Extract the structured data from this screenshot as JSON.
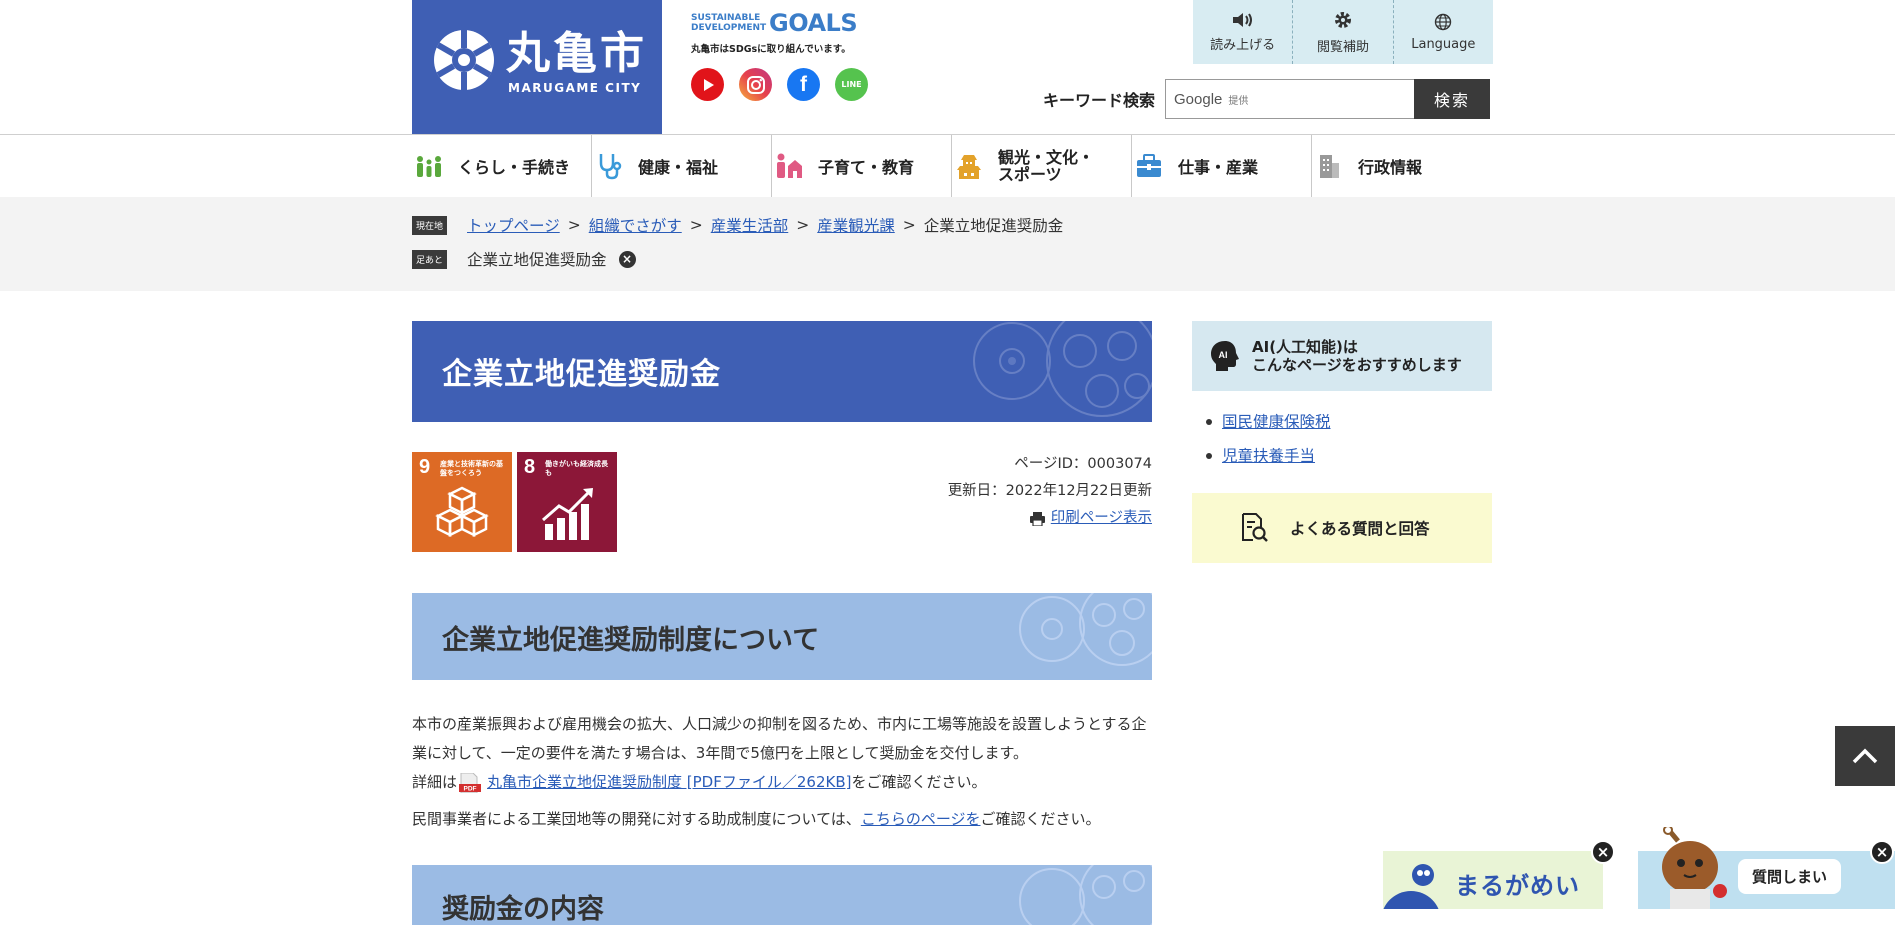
{
  "header": {
    "logo": {
      "name_jp": "丸亀市",
      "name_en": "MARUGAME CITY"
    },
    "sdgs": {
      "line_sd": "SUSTAINABLE DEVELOPMENT",
      "goals": "GOALS",
      "note": "丸亀市はSDGsに取り組んでいます。"
    },
    "social": [
      {
        "icon": "youtube-icon"
      },
      {
        "icon": "instagram-icon"
      },
      {
        "icon": "facebook-icon",
        "glyph": "f"
      },
      {
        "icon": "line-icon",
        "glyph": "LINE"
      }
    ],
    "tools": [
      {
        "label": "読み上げる",
        "icon": "speaker-icon"
      },
      {
        "label": "閲覧補助",
        "icon": "gear-icon"
      },
      {
        "label": "Language",
        "icon": "globe-icon"
      }
    ],
    "search": {
      "label": "キーワード検索",
      "provider": "Google",
      "provided": "提供",
      "button": "検索"
    }
  },
  "gnav": [
    {
      "label": "くらし・手続き",
      "icon": "people-icon",
      "color": "#5aa83c"
    },
    {
      "label": "健康・福祉",
      "icon": "stethoscope-icon",
      "color": "#3a9ad9"
    },
    {
      "label": "子育て・教育",
      "icon": "family-icon",
      "color": "#e05a83"
    },
    {
      "label_line1": "観光・文化・",
      "label_line2": "スポーツ",
      "icon": "castle-icon",
      "color": "#e3a22a"
    },
    {
      "label": "仕事・産業",
      "icon": "briefcase-icon",
      "color": "#3a8ad0"
    },
    {
      "label": "行政情報",
      "icon": "building-icon",
      "color": "#888888"
    }
  ],
  "breadcrumb": {
    "current_tag": "現在地",
    "items": [
      "トップページ",
      "組織でさがす",
      "産業生活部",
      "産業観光課"
    ],
    "current": "企業立地促進奨励金",
    "separator": ">",
    "history_tag": "足あと",
    "history_item": "企業立地促進奨励金"
  },
  "main": {
    "title": "企業立地促進奨励金",
    "sdg_badges": [
      {
        "num": "9",
        "caption": "産業と技術革新の基盤をつくろう",
        "color": "#dd6a25"
      },
      {
        "num": "8",
        "caption": "働きがいも経済成長も",
        "color": "#8c1738"
      }
    ],
    "page_id": "ページID：0003074",
    "updated": "更新日：2022年12月22日更新",
    "print_link": "印刷ページ表示",
    "section1_title": "企業立地促進奨励制度について",
    "para1": "本市の産業振興および雇用機会の拡大、人口減少の抑制を図るため、市内に工場等施設を設置しようとする企業に対して、一定の要件を満たす場合は、3年間で5億円を上限として奨励金を交付します。",
    "para2_prefix": "詳細は",
    "para2_link": "丸亀市企業立地促進奨励制度 [PDFファイル／262KB]",
    "para2_suffix": "をご確認ください。",
    "para3_prefix": "民間事業者による工業団地等の開発に対する助成制度については、",
    "para3_link": "こちらのページを",
    "para3_suffix": "ご確認ください。",
    "section2_title": "奨励金の内容"
  },
  "sidebar": {
    "ai_title_line1": "AI(人工知能)は",
    "ai_title_line2": "こんなページをおすすめします",
    "ai_head_text": "AI",
    "ai_links": [
      "国民健康保険税",
      "児童扶養手当"
    ],
    "faq": "よくある質問と回答"
  },
  "floating": {
    "banner1_text": "まるがめいと",
    "banner2_text": "質問しまい",
    "close": "×"
  },
  "colors": {
    "brand": "#3f5fb4",
    "h2": "#9bbbe4",
    "link": "#2a5cb8",
    "tools_bg": "#d8ecf2"
  }
}
